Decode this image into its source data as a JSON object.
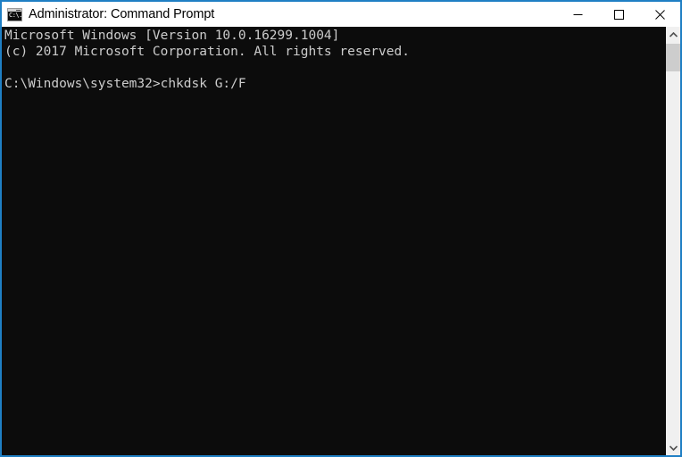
{
  "window": {
    "title": "Administrator: Command Prompt",
    "icon_name": "console-icon",
    "icon_glyph": "C:\\.",
    "border_color": "#1f7fc4",
    "titlebar_bg": "#ffffff",
    "titlebar_fg": "#000000"
  },
  "controls": {
    "minimize_label": "Minimize",
    "maximize_label": "Maximize",
    "close_label": "Close"
  },
  "console": {
    "background": "#0c0c0c",
    "foreground": "#cccccc",
    "lines": [
      "Microsoft Windows [Version 10.0.16299.1004]",
      "(c) 2017 Microsoft Corporation. All rights reserved.",
      "",
      "C:\\Windows\\system32>chkdsk G:/F"
    ],
    "text": "Microsoft Windows [Version 10.0.16299.1004]\n(c) 2017 Microsoft Corporation. All rights reserved.\n\nC:\\Windows\\system32>chkdsk G:/F",
    "prompt": "C:\\Windows\\system32>",
    "command": "chkdsk G:/F"
  },
  "scrollbar": {
    "up_arrow": "▲",
    "down_arrow": "▼",
    "thumb_position_percent": 0,
    "track_color": "#f0f0f0",
    "thumb_color": "#cdcdcd"
  }
}
